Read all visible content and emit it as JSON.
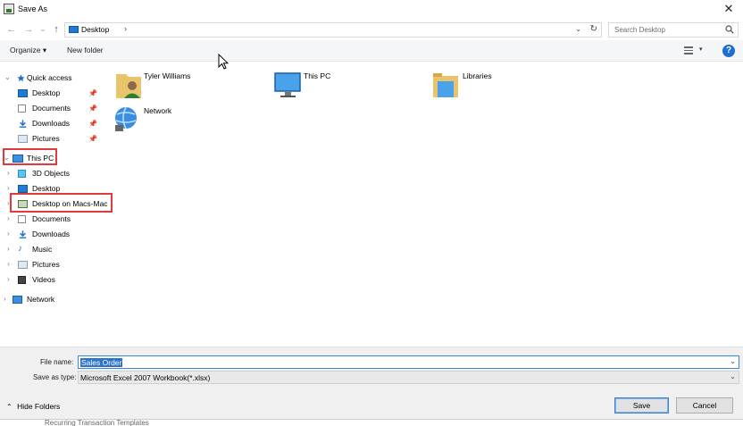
{
  "window": {
    "title": "Save As",
    "close_glyph": "✕"
  },
  "nav": {
    "back": "←",
    "forward": "→",
    "dropdown": "⌄",
    "up": "↑"
  },
  "address": {
    "path": "Desktop",
    "separator": "›",
    "dropdown": "⌄",
    "refresh": "↻"
  },
  "search": {
    "placeholder": "Search Desktop"
  },
  "toolbar": {
    "organize": "Organize ▾",
    "new_folder": "New folder",
    "view_dropdown": "▾",
    "help": "?"
  },
  "tree": {
    "quick_access": "Quick access",
    "quick_items": [
      "Desktop",
      "Documents",
      "Downloads",
      "Pictures"
    ],
    "this_pc": "This PC",
    "pc_items": [
      "3D Objects",
      "Desktop",
      "Desktop on Macs-Mac",
      "Documents",
      "Downloads",
      "Music",
      "Pictures",
      "Videos"
    ],
    "network": "Network"
  },
  "content": {
    "items": [
      "Tyler Williams",
      "This PC",
      "Libraries",
      "Network"
    ]
  },
  "bottom": {
    "file_name_label": "File name:",
    "file_name_value": "Sales Order",
    "save_type_label": "Save as type:",
    "save_type_value": "Microsoft Excel 2007 Workbook(*.xlsx)",
    "hide_folders": "Hide Folders",
    "save_button": "Save",
    "cancel_button": "Cancel",
    "dropdown": "⌄"
  },
  "background_strip": {
    "text": "Recurring Transaction Templates"
  },
  "colors": {
    "accent": "#1c6fd1",
    "highlight": "#e03a3a",
    "selection": "#3074c9"
  }
}
